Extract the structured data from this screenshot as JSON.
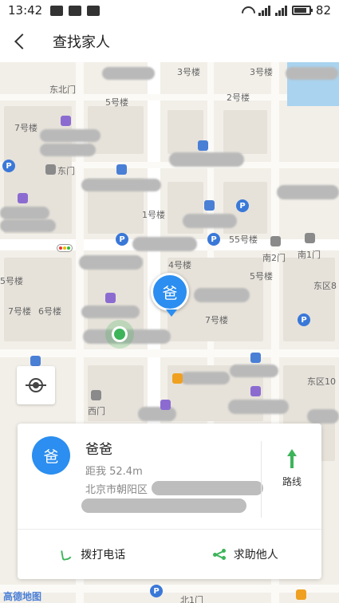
{
  "status_bar": {
    "time": "13:42",
    "battery": "82",
    "battery_level": 0.82
  },
  "header": {
    "title": "查找家人"
  },
  "map": {
    "labels": {
      "l1": "东北门",
      "l2": "7号楼",
      "l3": "东门",
      "l4": "1号楼",
      "l5": "55号楼",
      "l6": "4号楼",
      "l7": "5号楼",
      "l8": "南2门",
      "l9": "南1门",
      "l10": "5号楼",
      "l11": "7号楼",
      "l12": "6号楼",
      "l13": "7号楼",
      "l14": "东区8",
      "l15": "东区10",
      "l16": "西门",
      "l17": "3号楼",
      "l18": "2号楼",
      "l19": "3号楼",
      "l20": "5号楼",
      "l21": "北1门"
    },
    "parking": "P"
  },
  "marker": {
    "label": "爸"
  },
  "card": {
    "avatar": "爸",
    "name": "爸爸",
    "distance": "距我 52.4m",
    "address": "北京市朝阳区",
    "route_label": "路线",
    "call_label": "拨打电话",
    "help_label": "求助他人"
  },
  "footer": {
    "logo": "高德地图"
  }
}
